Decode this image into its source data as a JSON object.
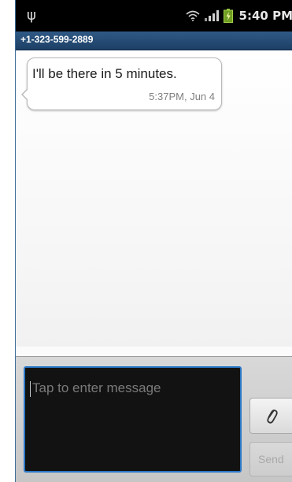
{
  "status_bar": {
    "time": "5:40 PM",
    "icons": [
      "usb-icon",
      "wifi-icon",
      "signal-icon",
      "battery-icon"
    ]
  },
  "header": {
    "phone_number": "+1-323-599-2889"
  },
  "conversation": {
    "messages": [
      {
        "text": "I'll be there in 5 minutes.",
        "timestamp": "5:37PM, Jun 4"
      }
    ]
  },
  "composer": {
    "placeholder": "Tap to enter message",
    "send_label": "Send",
    "attach_icon": "paperclip-icon"
  },
  "colors": {
    "title_bar": "#244a74",
    "input_focus": "#2b78c8"
  }
}
